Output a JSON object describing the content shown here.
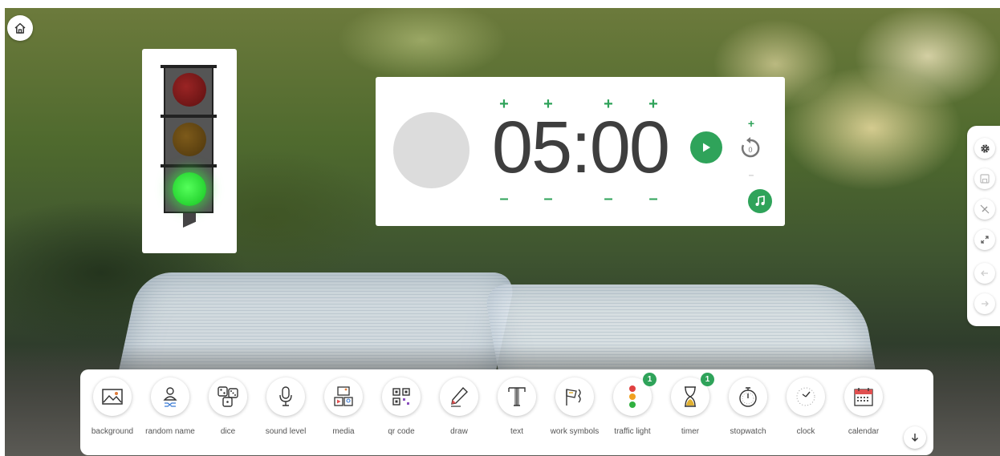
{
  "timer": {
    "display": "05:00",
    "plus": "+",
    "minus": "–",
    "accent": "#2fa35a"
  },
  "traffic_light": {
    "active": "green",
    "colors": {
      "red": "#7a1a1a",
      "amber": "#6b4a14",
      "green": "#2ee03a"
    }
  },
  "side_toolbar": [
    "gear-icon",
    "save-icon",
    "no-draw-icon",
    "fullscreen-icon",
    "back-arrow-icon",
    "forward-arrow-icon"
  ],
  "dock": {
    "items": [
      {
        "label": "background"
      },
      {
        "label": "random name"
      },
      {
        "label": "dice"
      },
      {
        "label": "sound level"
      },
      {
        "label": "media"
      },
      {
        "label": "qr code"
      },
      {
        "label": "draw"
      },
      {
        "label": "text"
      },
      {
        "label": "work symbols"
      },
      {
        "label": "traffic light",
        "badge": "1"
      },
      {
        "label": "timer",
        "badge": "1"
      },
      {
        "label": "stopwatch"
      },
      {
        "label": "clock"
      },
      {
        "label": "calendar"
      }
    ]
  }
}
